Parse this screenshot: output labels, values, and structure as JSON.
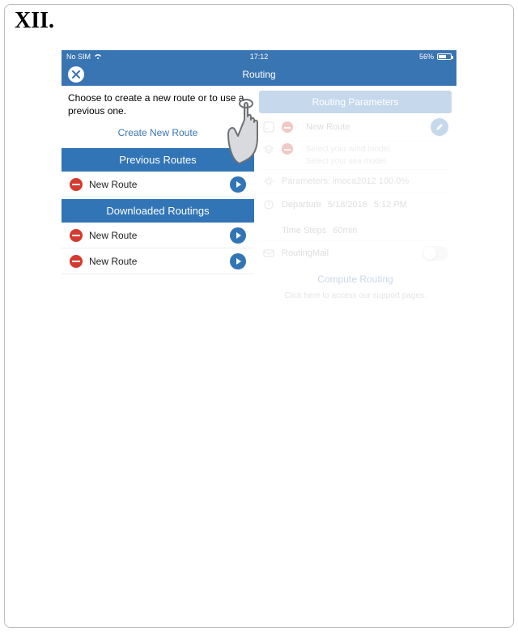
{
  "figure_label": "XII.",
  "status": {
    "carrier": "No SIM",
    "time": "17:12",
    "battery_pct": "56%"
  },
  "nav": {
    "title": "Routing"
  },
  "left": {
    "instruction": "Choose to create a new route or to use a previous one.",
    "create_link": "Create New Route",
    "previous_header": "Previous Routes",
    "previous_items": [
      "New Route"
    ],
    "downloaded_header": "Downloaded Routings",
    "downloaded_items": [
      "New Route",
      "New Route"
    ]
  },
  "right": {
    "header": "Routing Parameters",
    "route_name": "New Route",
    "wind_placeholder": "Select your wind model",
    "sea_placeholder": "Select your sea model",
    "parameters": "Parameters: imoca2012 100.0%",
    "departure_label": "Departure",
    "departure_date": "5/18/2016",
    "departure_time": "5:12 PM",
    "timesteps_label": "Time Steps",
    "timesteps_value": "60min",
    "routing_mail": "RoutingMail",
    "compute": "Compute Routing",
    "support": "Click here to access our support pages."
  }
}
